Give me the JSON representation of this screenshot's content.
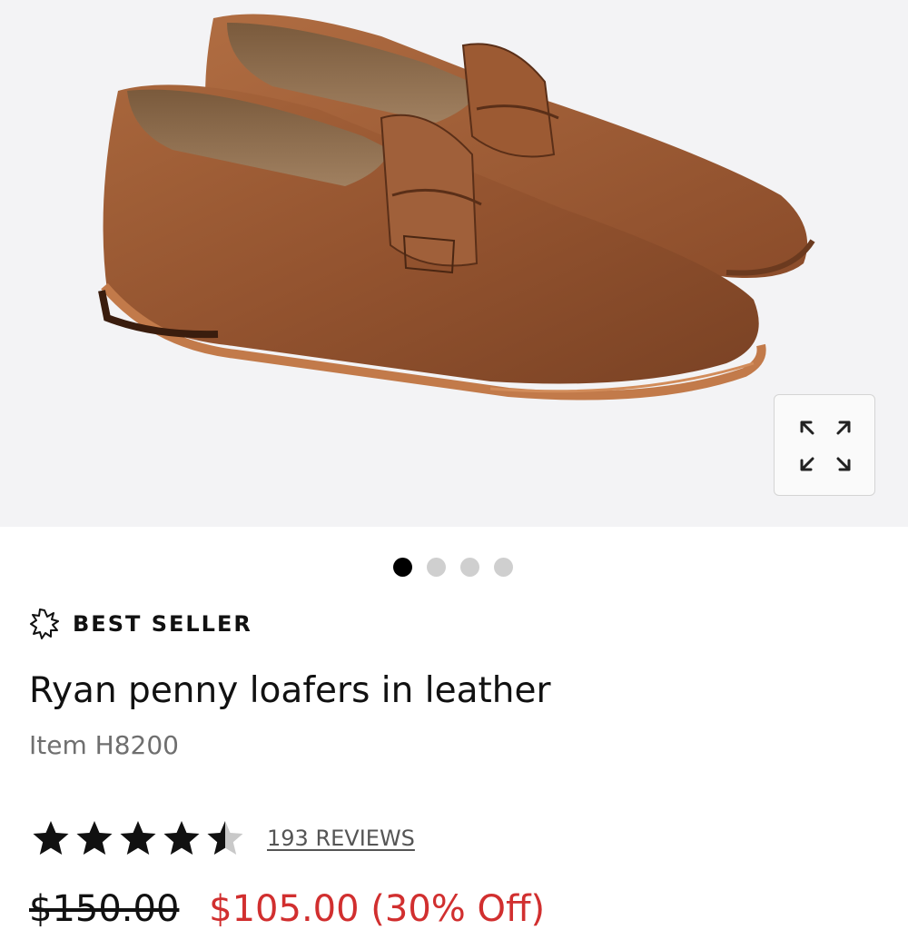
{
  "product": {
    "image_alt": "Ryan penny loafers in leather",
    "expand_icon": "expand-icon",
    "gallery": {
      "image_count": 4,
      "active_index": 0
    },
    "badge": {
      "icon": "starburst-icon",
      "label": "BEST SELLER"
    },
    "title": "Ryan penny loafers in leather",
    "item_number": "Item H8200",
    "rating": {
      "value": 4.5,
      "max": 5,
      "reviews_label": "193 REVIEWS"
    },
    "price": {
      "original": "$150.00",
      "sale": "$105.00 (30% Off)"
    }
  },
  "colors": {
    "hero_bg": "#f3f3f5",
    "leather": "#9b5a34",
    "sale_red": "#d12f2f",
    "dot_active": "#000000",
    "dot_inactive": "#cfcfcf"
  }
}
